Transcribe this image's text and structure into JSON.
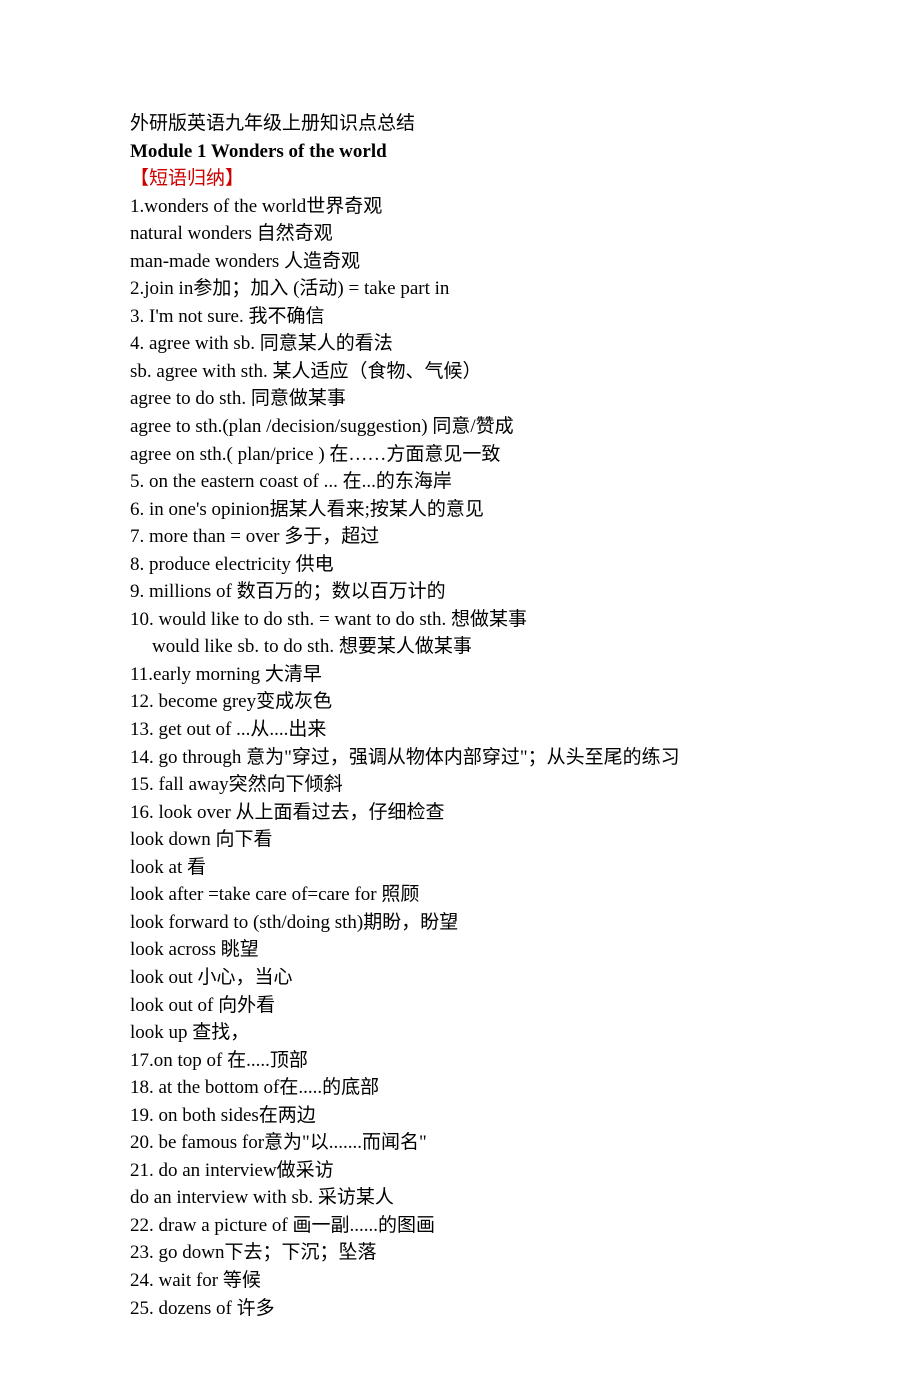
{
  "title": "外研版英语九年级上册知识点总结",
  "module_heading": "Module 1  Wonders of the world",
  "section_label": "【短语归纳】",
  "lines": [
    "1.wonders of the world世界奇观",
    "natural wonders 自然奇观",
    "man-made wonders 人造奇观",
    "2.join in参加；加入 (活动) = take part in",
    "3. I'm not sure. 我不确信",
    "4. agree with sb. 同意某人的看法",
    "sb. agree with sth. 某人适应（食物、气候）",
    "agree to do sth. 同意做某事",
    "agree to sth.(plan /decision/suggestion) 同意/赞成",
    "agree on sth.( plan/price ) 在……方面意见一致",
    "5. on the eastern coast of ... 在...的东海岸",
    "6. in one's opinion据某人看来;按某人的意见",
    "7. more than = over 多于，超过",
    "8. produce electricity 供电",
    "9. millions of 数百万的；数以百万计的",
    "10. would like to do sth. = want to do sth. 想做某事"
  ],
  "line_indent": "would like sb. to do sth. 想要某人做某事",
  "lines2": [
    "11.early morning 大清早",
    "12. become grey变成灰色",
    "13. get out of ...从....出来",
    "14. go through 意为\"穿过，强调从物体内部穿过\"；从头至尾的练习",
    "15. fall away突然向下倾斜",
    "16. look over 从上面看过去，仔细检查",
    "look down 向下看",
    "look at 看",
    "look after =take care of=care for 照顾",
    "look forward to (sth/doing sth)期盼，盼望",
    "look across 眺望",
    "look out 小心，当心",
    "look out of 向外看",
    "look up 查找，",
    "17.on top of 在.....顶部",
    "18. at the bottom of在.....的底部",
    "19. on both sides在两边",
    "20. be famous for意为\"以.......而闻名\"",
    "21. do an interview做采访",
    "do an interview with sb. 采访某人",
    "22. draw a picture of 画一副......的图画",
    "23. go down下去；下沉；坠落",
    "24. wait for 等候",
    "25. dozens of 许多"
  ]
}
